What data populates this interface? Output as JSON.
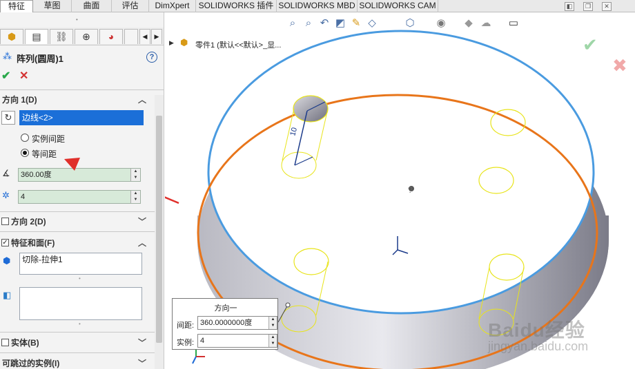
{
  "tabs": [
    "特征",
    "草图",
    "曲面",
    "评估",
    "DimXpert",
    "SOLIDWORKS 插件",
    "SOLIDWORKS MBD",
    "SOLIDWORKS CAM"
  ],
  "window_controls": [
    "◧",
    "❐",
    "✕"
  ],
  "panel": {
    "title": "阵列(圆周)1",
    "help": "?",
    "ok": "✔",
    "cancel": "✕",
    "tab_icons": [
      "feature-manager-icon",
      "property-manager-icon",
      "configuration-manager-icon",
      "dimxpert-icon",
      "display-manager-icon"
    ],
    "direction1": {
      "label": "方向 1(D)",
      "edge_value": "边线<2>",
      "radio_instance_spacing": "实例间距",
      "radio_equal_spacing": "等间距",
      "angle_value": "360.00度",
      "count_value": "4"
    },
    "direction2": {
      "label": "方向 2(D)"
    },
    "features": {
      "label": "特征和面(F)",
      "list_item": "切除-拉伸1"
    },
    "bodies": {
      "label": "实体(B)"
    },
    "skip": {
      "label": "可跳过的实例(I)"
    }
  },
  "tree": {
    "part_label": "零件1 (默认<<默认>_显..."
  },
  "popup": {
    "title": "方向一",
    "spacing_label": "间距:",
    "spacing_value": "360.0000000度",
    "count_label": "实例:",
    "count_value": "4"
  },
  "watermark": {
    "brand": "Baidu经验",
    "url": "jingyan.baidu.com"
  },
  "colors": {
    "accent_blue": "#1e6bd6",
    "ok_green": "#2aa84a",
    "cancel_red": "#d33131",
    "edge_orange": "#e8751a",
    "circle_blue": "#4a9be0",
    "preview_yellow": "#e8e41a",
    "arrow_red": "#e0302b"
  }
}
